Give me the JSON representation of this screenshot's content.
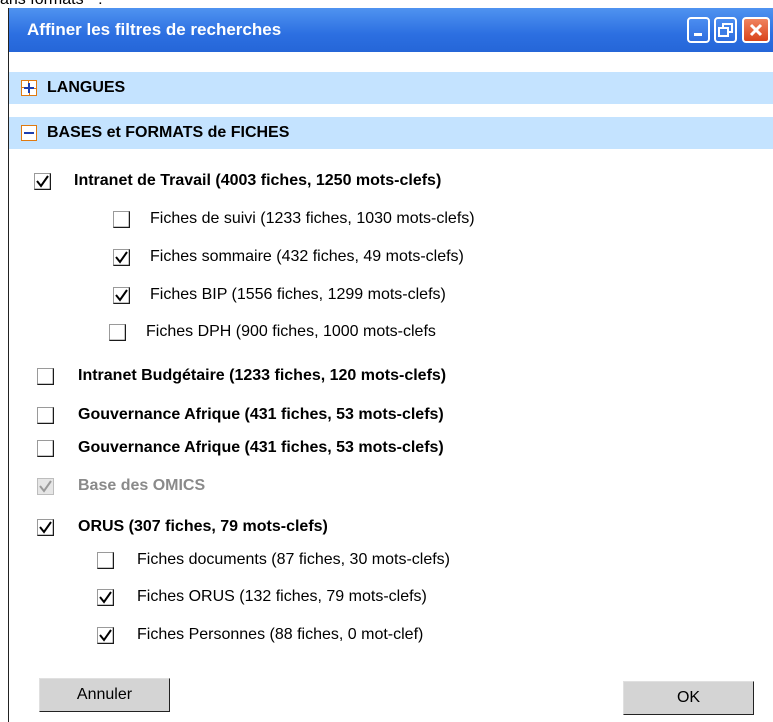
{
  "top_text": "ans formats \" :",
  "window": {
    "title": "Affiner les filtres de recherches",
    "controls": {
      "minimize_icon": "minimize-icon",
      "restore_icon": "restore-icon",
      "close_icon": "close-icon"
    }
  },
  "sections": [
    {
      "label": "LANGUES",
      "state": "collapsed",
      "icon": "expand-plus-icon"
    },
    {
      "label": "BASES et FORMATS de FICHES",
      "state": "expanded",
      "icon": "collapse-minus-icon"
    }
  ],
  "bases": [
    {
      "label": "Intranet de Travail (4003 fiches, 1250 mots-clefs)",
      "checked": true,
      "enabled": true,
      "children": [
        {
          "label": "Fiches de suivi (1233 fiches, 1030 mots-clefs)",
          "checked": false
        },
        {
          "label": "Fiches sommaire (432 fiches, 49 mots-clefs)",
          "checked": true
        },
        {
          "label": "Fiches BIP (1556 fiches, 1299 mots-clefs)",
          "checked": true
        },
        {
          "label": "Fiches DPH (900 fiches, 1000 mots-clefs",
          "checked": false
        }
      ]
    },
    {
      "label": "Intranet Budgétaire (1233 fiches, 120 mots-clefs)",
      "checked": false,
      "enabled": true
    },
    {
      "label": "Gouvernance Afrique (431 fiches, 53 mots-clefs)",
      "checked": false,
      "enabled": true
    },
    {
      "label": "Gouvernance Afrique (431 fiches, 53 mots-clefs)",
      "checked": false,
      "enabled": true
    },
    {
      "label": "Base des OMICS",
      "checked": true,
      "enabled": false
    },
    {
      "label": "ORUS (307 fiches, 79 mots-clefs)",
      "checked": true,
      "enabled": true,
      "children": [
        {
          "label": "Fiches documents (87 fiches, 30 mots-clefs)",
          "checked": false
        },
        {
          "label": "Fiches ORUS (132 fiches, 79 mots-clefs)",
          "checked": true
        },
        {
          "label": "Fiches Personnes (88 fiches, 0 mot-clef)",
          "checked": true
        }
      ]
    }
  ],
  "buttons": {
    "cancel": "Annuler",
    "ok": "OK"
  },
  "colors": {
    "titlebar": "#2c6fe1",
    "section_bg": "#c4e3ff",
    "button_bg": "#d4d4d4",
    "disabled_text": "#8a8a8a"
  }
}
